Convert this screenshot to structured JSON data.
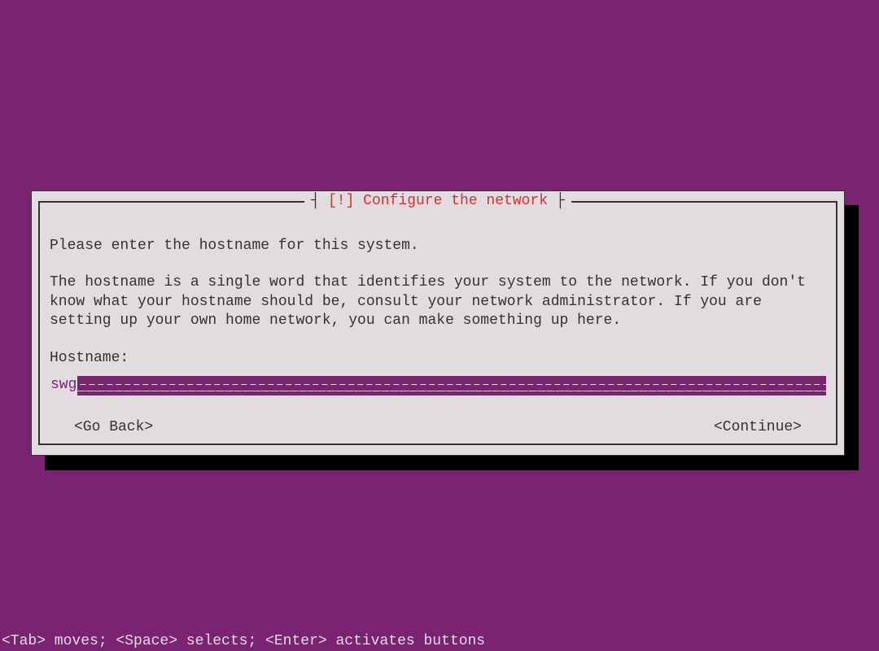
{
  "dialog": {
    "title_prefix": "┤",
    "title": "[!] Configure the network",
    "title_suffix": "├",
    "intro": "Please enter the hostname for this system.",
    "description": "The hostname is a single word that identifies your system to the network. If you don't know what your hostname should be, consult your network administrator. If you are setting up your own home network, you can make something up here.",
    "field_label": "Hostname:",
    "field_value": "swg",
    "go_back": "<Go Back>",
    "continue": "<Continue>"
  },
  "footer": {
    "hint": "<Tab> moves; <Space> selects; <Enter> activates buttons"
  }
}
